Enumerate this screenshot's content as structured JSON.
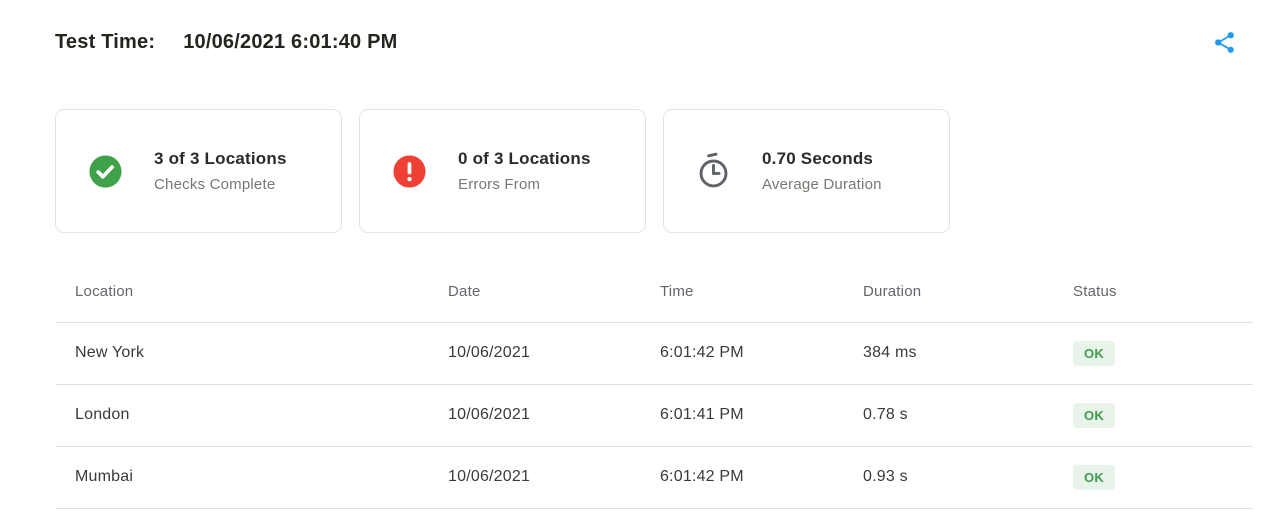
{
  "header": {
    "test_time_label": "Test Time:",
    "test_time_value": "10/06/2021 6:01:40 PM"
  },
  "icons": {
    "share": "share-icon",
    "checks_complete": "check-circle-icon",
    "errors": "error-circle-icon",
    "duration": "stopwatch-icon"
  },
  "colors": {
    "accent_blue": "#1d9bf0",
    "success_green": "#3fa24a",
    "error_red": "#ee4035",
    "icon_gray": "#5f6368",
    "badge_bg": "#e8f3e9",
    "badge_text": "#3f9b4f"
  },
  "summary_cards": [
    {
      "title": "3 of 3 Locations",
      "subtitle": "Checks Complete",
      "icon": "check-circle-icon"
    },
    {
      "title": "0 of 3 Locations",
      "subtitle": "Errors From",
      "icon": "error-circle-icon"
    },
    {
      "title": "0.70 Seconds",
      "subtitle": "Average Duration",
      "icon": "stopwatch-icon"
    }
  ],
  "results_table": {
    "columns": [
      "Location",
      "Date",
      "Time",
      "Duration",
      "Status"
    ],
    "rows": [
      {
        "location": "New York",
        "date": "10/06/2021",
        "time": "6:01:42 PM",
        "duration": "384 ms",
        "status": "OK"
      },
      {
        "location": "London",
        "date": "10/06/2021",
        "time": "6:01:41 PM",
        "duration": "0.78 s",
        "status": "OK"
      },
      {
        "location": "Mumbai",
        "date": "10/06/2021",
        "time": "6:01:42 PM",
        "duration": "0.93 s",
        "status": "OK"
      }
    ]
  }
}
